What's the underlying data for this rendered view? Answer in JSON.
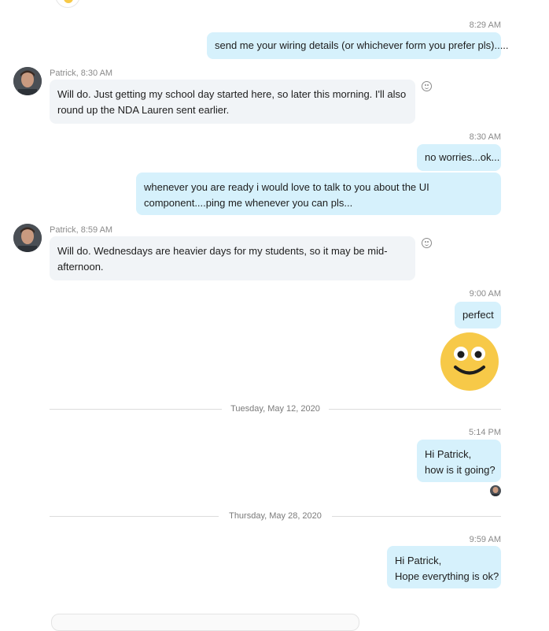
{
  "conversation": {
    "messages": [
      {
        "time": "8:29 AM",
        "lines": [
          "send me your wiring details (or whichever form you prefer pls)....."
        ]
      },
      {
        "sender": "Patrick, 8:30 AM",
        "lines": [
          "Will do. Just getting my school day started here, so later this morning. I'll also",
          "round up the NDA Lauren sent earlier."
        ]
      },
      {
        "time": "8:30 AM",
        "lines": [
          "no worries...ok..."
        ]
      },
      {
        "lines": [
          "whenever you are ready i would love to talk to you about the UI",
          "component....ping me whenever you can pls..."
        ]
      },
      {
        "sender": "Patrick, 8:59 AM",
        "lines": [
          "Will do. Wednesdays are heavier days for my students, so it may be mid-",
          "afternoon."
        ]
      },
      {
        "time": "9:00 AM",
        "lines": [
          "perfect"
        ]
      },
      {
        "date": "Tuesday, May 12, 2020"
      },
      {
        "time": "5:14 PM",
        "lines": [
          "Hi Patrick,",
          "how is it going?"
        ]
      },
      {
        "date": "Thursday, May 28, 2020"
      },
      {
        "time": "9:59 AM",
        "lines": [
          "Hi Patrick,",
          "Hope everything is ok?"
        ]
      }
    ]
  },
  "colors": {
    "outgoing_bubble": "#d6f1fc",
    "incoming_bubble": "#f1f4f7",
    "emoji_face": "#f7c948"
  }
}
